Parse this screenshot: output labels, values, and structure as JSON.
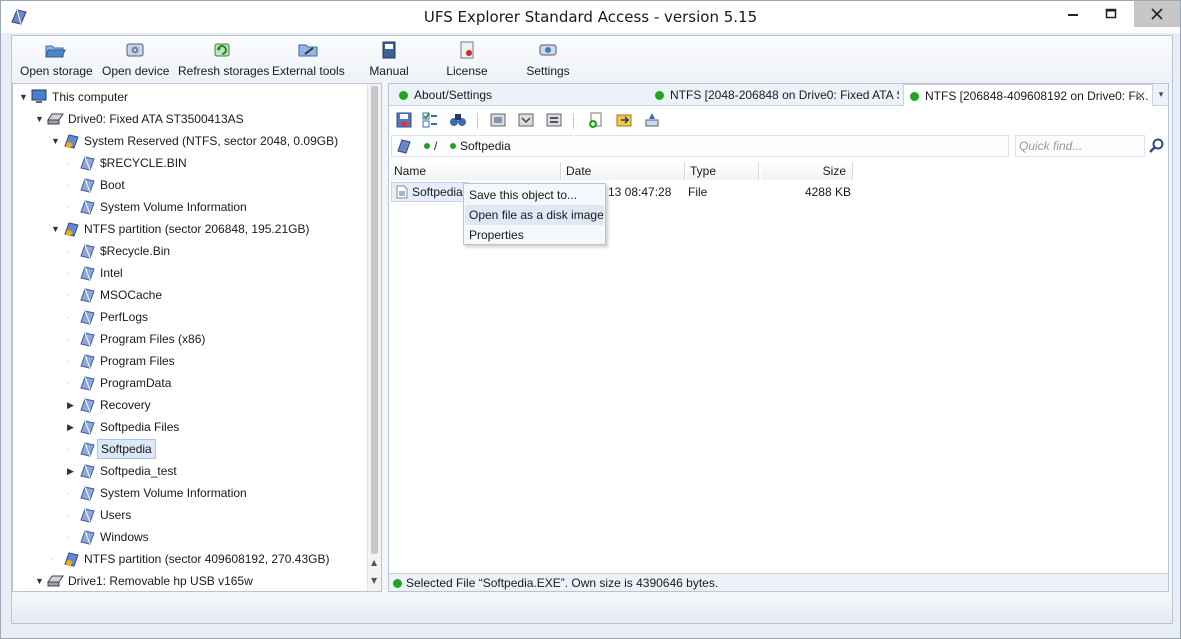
{
  "window": {
    "title": "UFS Explorer Standard Access - version 5.15",
    "controls": [
      "minimize",
      "maximize",
      "close"
    ]
  },
  "toolbar": {
    "buttons": [
      {
        "label": "Open storage",
        "icon": "folder-open-icon"
      },
      {
        "label": "Open device",
        "icon": "device-icon"
      },
      {
        "label": "Refresh storages",
        "icon": "refresh-icon"
      },
      {
        "label": "External tools",
        "icon": "tools-icon"
      },
      {
        "label": "Manual",
        "icon": "manual-icon"
      },
      {
        "label": "License",
        "icon": "license-icon"
      },
      {
        "label": "Settings",
        "icon": "settings-icon"
      }
    ]
  },
  "tree": {
    "items": [
      {
        "label": "This computer",
        "icon": "computer-icon",
        "expander": "expanded"
      },
      {
        "label": "Drive0: Fixed ATA ST3500413AS",
        "icon": "drive-icon",
        "expander": "expanded"
      },
      {
        "label": "System Reserved (NTFS, sector 2048, 0.09GB)",
        "icon": "partition-icon",
        "expander": "expanded"
      },
      {
        "label": "$RECYCLE.BIN",
        "icon": "folder-icon",
        "expander": "none"
      },
      {
        "label": "Boot",
        "icon": "folder-icon",
        "expander": "none"
      },
      {
        "label": "System Volume Information",
        "icon": "folder-icon",
        "expander": "none"
      },
      {
        "label": "NTFS partition (sector 206848, 195.21GB)",
        "icon": "partition-icon",
        "expander": "expanded"
      },
      {
        "label": "$Recycle.Bin",
        "icon": "folder-icon",
        "expander": "none"
      },
      {
        "label": "Intel",
        "icon": "folder-icon",
        "expander": "none"
      },
      {
        "label": "MSOCache",
        "icon": "folder-icon",
        "expander": "none"
      },
      {
        "label": "PerfLogs",
        "icon": "folder-icon",
        "expander": "none"
      },
      {
        "label": "Program Files (x86)",
        "icon": "folder-icon",
        "expander": "none"
      },
      {
        "label": "Program Files",
        "icon": "folder-icon",
        "expander": "none"
      },
      {
        "label": "ProgramData",
        "icon": "folder-icon",
        "expander": "none"
      },
      {
        "label": "Recovery",
        "icon": "folder-icon",
        "expander": "collapsed"
      },
      {
        "label": "Softpedia Files",
        "icon": "folder-icon",
        "expander": "collapsed"
      },
      {
        "label": "Softpedia",
        "icon": "folder-icon",
        "expander": "none",
        "selected": true
      },
      {
        "label": "Softpedia_test",
        "icon": "folder-icon",
        "expander": "collapsed"
      },
      {
        "label": "System Volume Information",
        "icon": "folder-icon",
        "expander": "none"
      },
      {
        "label": "Users",
        "icon": "folder-icon",
        "expander": "none"
      },
      {
        "label": "Windows",
        "icon": "folder-icon",
        "expander": "none"
      },
      {
        "label": "NTFS partition (sector 409608192, 270.43GB)",
        "icon": "partition-icon",
        "expander": "none"
      },
      {
        "label": "Drive1: Removable hp USB v165w",
        "icon": "drive-icon",
        "expander": "expanded"
      }
    ]
  },
  "tabs": [
    {
      "label": "About/Settings",
      "active": false
    },
    {
      "label": "NTFS [2048-206848 on Drive0: Fixed ATA S...",
      "active": false
    },
    {
      "label": "NTFS [206848-409608192 on Drive0: Fi...",
      "active": true,
      "close": "✕"
    }
  ],
  "tab_more": "▾",
  "path": {
    "root": "/",
    "current": "Softpedia"
  },
  "search": {
    "placeholder": "Quick find..."
  },
  "file_list": {
    "columns": [
      "Name",
      "Date",
      "Type",
      "Size"
    ],
    "rows": [
      {
        "name": "Softpedia.EXE",
        "name_visible": "Softpedia.E",
        "date_visible": "13 08:47:28",
        "type": "File",
        "size": "4288 KB"
      }
    ]
  },
  "context_menu": {
    "items": [
      "Save this object to...",
      "Open file as a disk image",
      "Properties"
    ],
    "hover_index": 1
  },
  "status": {
    "text": "Selected File “Softpedia.EXE”. Own size is 4390646 bytes.",
    "status_color": "#1fa51f"
  },
  "colors": {
    "accent": "#1fa51f",
    "selection": "#dbe8f7"
  }
}
